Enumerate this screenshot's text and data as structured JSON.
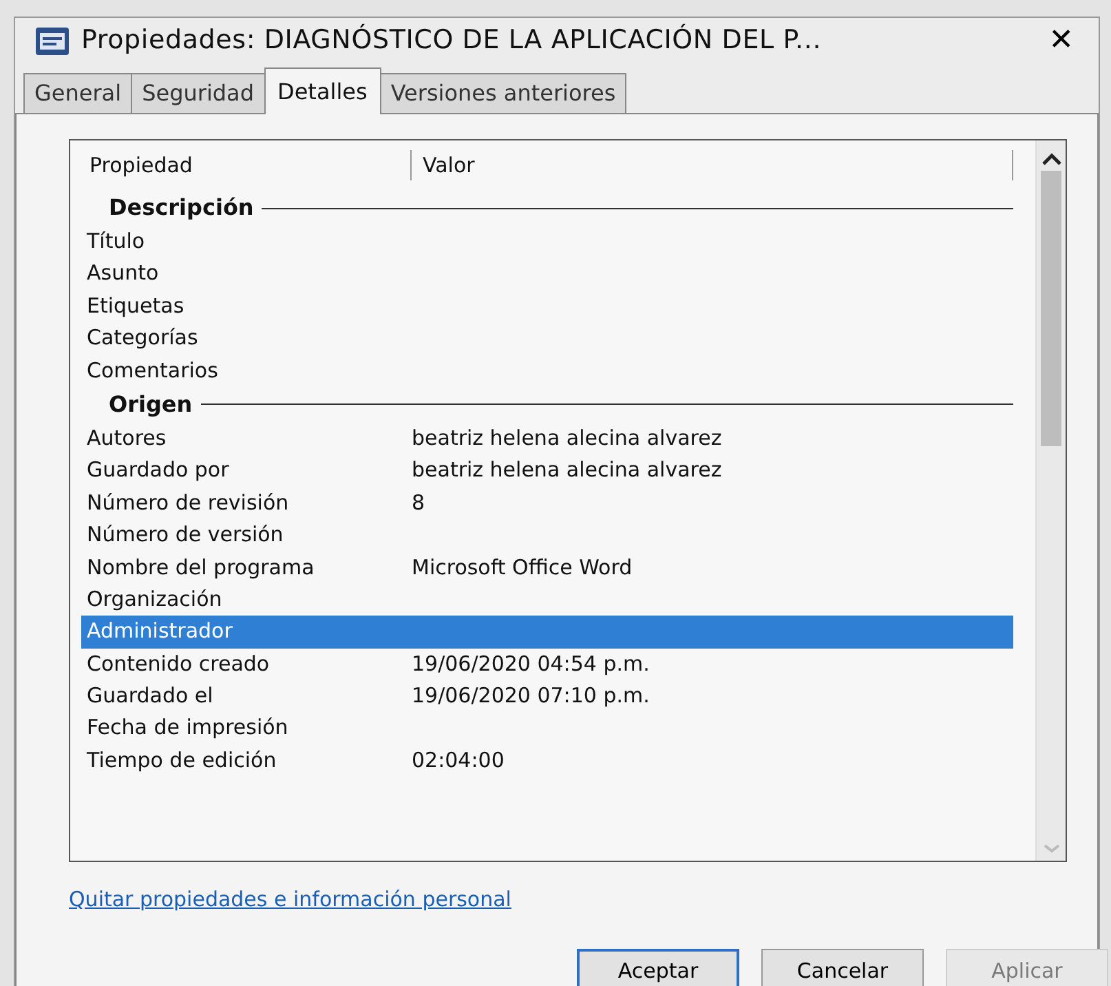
{
  "window": {
    "title": "Propiedades: DIAGNÓSTICO DE LA APLICACIÓN DEL P...",
    "close": "✕"
  },
  "tabs": [
    {
      "label": "General",
      "selected": false
    },
    {
      "label": "Seguridad",
      "selected": false
    },
    {
      "label": "Detalles",
      "selected": true
    },
    {
      "label": "Versiones anteriores",
      "selected": false
    }
  ],
  "table": {
    "columns": [
      "Propiedad",
      "Valor"
    ],
    "rows": [
      {
        "kind": "group",
        "label": "Descripción"
      },
      {
        "kind": "property",
        "name": "Título",
        "selected": false
      },
      {
        "kind": "property",
        "name": "Asunto",
        "selected": false
      },
      {
        "kind": "property",
        "name": "Etiquetas",
        "selected": false
      },
      {
        "kind": "property",
        "name": "Categorías",
        "selected": false
      },
      {
        "kind": "property",
        "name": "Comentarios",
        "selected": false
      },
      {
        "kind": "group",
        "label": "Origen"
      },
      {
        "kind": "property",
        "name": "Autores",
        "value": "beatriz helena alecina alvarez",
        "selected": false
      },
      {
        "kind": "property",
        "name": "Guardado por",
        "value": "beatriz helena alecina alvarez",
        "selected": false
      },
      {
        "kind": "property",
        "name": "Número de revisión",
        "value": "8",
        "selected": false
      },
      {
        "kind": "property",
        "name": "Número de versión",
        "selected": false
      },
      {
        "kind": "property",
        "name": "Nombre del programa",
        "value": "Microsoft Office Word",
        "selected": false
      },
      {
        "kind": "property",
        "name": "Organización",
        "selected": false
      },
      {
        "kind": "property",
        "name": "Administrador",
        "selected": true
      },
      {
        "kind": "property",
        "name": "Contenido creado",
        "value": "19/06/2020 04:54 p.m.",
        "selected": false
      },
      {
        "kind": "property",
        "name": "Guardado el",
        "value": "19/06/2020 07:10 p.m.",
        "selected": false
      },
      {
        "kind": "property",
        "name": "Fecha de impresión",
        "selected": false
      },
      {
        "kind": "property",
        "name": "Tiempo de edición",
        "value": "02:04:00",
        "selected": false
      }
    ]
  },
  "link": "Quitar propiedades e información personal",
  "buttons": [
    {
      "label": "Aceptar",
      "default": true,
      "disabled": false
    },
    {
      "label": "Cancelar",
      "default": false,
      "disabled": false
    },
    {
      "label": "Aplicar",
      "default": false,
      "disabled": true
    }
  ]
}
